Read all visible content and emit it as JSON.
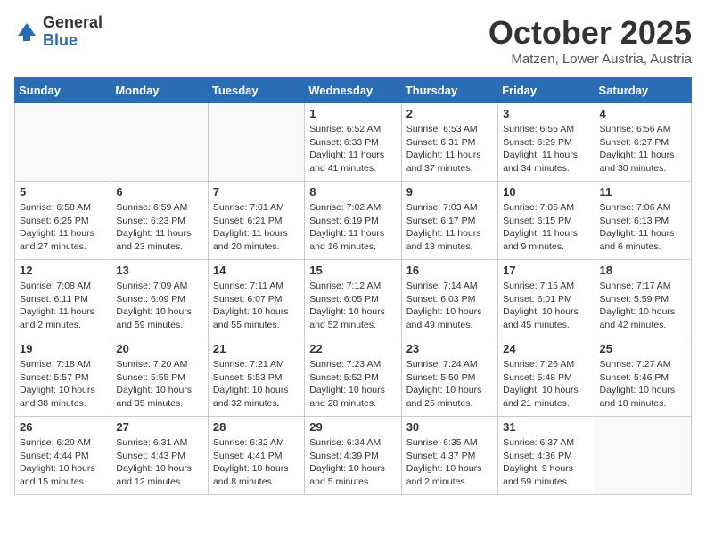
{
  "header": {
    "logo_general": "General",
    "logo_blue": "Blue",
    "title": "October 2025",
    "location": "Matzen, Lower Austria, Austria"
  },
  "weekdays": [
    "Sunday",
    "Monday",
    "Tuesday",
    "Wednesday",
    "Thursday",
    "Friday",
    "Saturday"
  ],
  "weeks": [
    [
      {
        "day": "",
        "info": ""
      },
      {
        "day": "",
        "info": ""
      },
      {
        "day": "",
        "info": ""
      },
      {
        "day": "1",
        "info": "Sunrise: 6:52 AM\nSunset: 6:33 PM\nDaylight: 11 hours\nand 41 minutes."
      },
      {
        "day": "2",
        "info": "Sunrise: 6:53 AM\nSunset: 6:31 PM\nDaylight: 11 hours\nand 37 minutes."
      },
      {
        "day": "3",
        "info": "Sunrise: 6:55 AM\nSunset: 6:29 PM\nDaylight: 11 hours\nand 34 minutes."
      },
      {
        "day": "4",
        "info": "Sunrise: 6:56 AM\nSunset: 6:27 PM\nDaylight: 11 hours\nand 30 minutes."
      }
    ],
    [
      {
        "day": "5",
        "info": "Sunrise: 6:58 AM\nSunset: 6:25 PM\nDaylight: 11 hours\nand 27 minutes."
      },
      {
        "day": "6",
        "info": "Sunrise: 6:59 AM\nSunset: 6:23 PM\nDaylight: 11 hours\nand 23 minutes."
      },
      {
        "day": "7",
        "info": "Sunrise: 7:01 AM\nSunset: 6:21 PM\nDaylight: 11 hours\nand 20 minutes."
      },
      {
        "day": "8",
        "info": "Sunrise: 7:02 AM\nSunset: 6:19 PM\nDaylight: 11 hours\nand 16 minutes."
      },
      {
        "day": "9",
        "info": "Sunrise: 7:03 AM\nSunset: 6:17 PM\nDaylight: 11 hours\nand 13 minutes."
      },
      {
        "day": "10",
        "info": "Sunrise: 7:05 AM\nSunset: 6:15 PM\nDaylight: 11 hours\nand 9 minutes."
      },
      {
        "day": "11",
        "info": "Sunrise: 7:06 AM\nSunset: 6:13 PM\nDaylight: 11 hours\nand 6 minutes."
      }
    ],
    [
      {
        "day": "12",
        "info": "Sunrise: 7:08 AM\nSunset: 6:11 PM\nDaylight: 11 hours\nand 2 minutes."
      },
      {
        "day": "13",
        "info": "Sunrise: 7:09 AM\nSunset: 6:09 PM\nDaylight: 10 hours\nand 59 minutes."
      },
      {
        "day": "14",
        "info": "Sunrise: 7:11 AM\nSunset: 6:07 PM\nDaylight: 10 hours\nand 55 minutes."
      },
      {
        "day": "15",
        "info": "Sunrise: 7:12 AM\nSunset: 6:05 PM\nDaylight: 10 hours\nand 52 minutes."
      },
      {
        "day": "16",
        "info": "Sunrise: 7:14 AM\nSunset: 6:03 PM\nDaylight: 10 hours\nand 49 minutes."
      },
      {
        "day": "17",
        "info": "Sunrise: 7:15 AM\nSunset: 6:01 PM\nDaylight: 10 hours\nand 45 minutes."
      },
      {
        "day": "18",
        "info": "Sunrise: 7:17 AM\nSunset: 5:59 PM\nDaylight: 10 hours\nand 42 minutes."
      }
    ],
    [
      {
        "day": "19",
        "info": "Sunrise: 7:18 AM\nSunset: 5:57 PM\nDaylight: 10 hours\nand 38 minutes."
      },
      {
        "day": "20",
        "info": "Sunrise: 7:20 AM\nSunset: 5:55 PM\nDaylight: 10 hours\nand 35 minutes."
      },
      {
        "day": "21",
        "info": "Sunrise: 7:21 AM\nSunset: 5:53 PM\nDaylight: 10 hours\nand 32 minutes."
      },
      {
        "day": "22",
        "info": "Sunrise: 7:23 AM\nSunset: 5:52 PM\nDaylight: 10 hours\nand 28 minutes."
      },
      {
        "day": "23",
        "info": "Sunrise: 7:24 AM\nSunset: 5:50 PM\nDaylight: 10 hours\nand 25 minutes."
      },
      {
        "day": "24",
        "info": "Sunrise: 7:26 AM\nSunset: 5:48 PM\nDaylight: 10 hours\nand 21 minutes."
      },
      {
        "day": "25",
        "info": "Sunrise: 7:27 AM\nSunset: 5:46 PM\nDaylight: 10 hours\nand 18 minutes."
      }
    ],
    [
      {
        "day": "26",
        "info": "Sunrise: 6:29 AM\nSunset: 4:44 PM\nDaylight: 10 hours\nand 15 minutes."
      },
      {
        "day": "27",
        "info": "Sunrise: 6:31 AM\nSunset: 4:43 PM\nDaylight: 10 hours\nand 12 minutes."
      },
      {
        "day": "28",
        "info": "Sunrise: 6:32 AM\nSunset: 4:41 PM\nDaylight: 10 hours\nand 8 minutes."
      },
      {
        "day": "29",
        "info": "Sunrise: 6:34 AM\nSunset: 4:39 PM\nDaylight: 10 hours\nand 5 minutes."
      },
      {
        "day": "30",
        "info": "Sunrise: 6:35 AM\nSunset: 4:37 PM\nDaylight: 10 hours\nand 2 minutes."
      },
      {
        "day": "31",
        "info": "Sunrise: 6:37 AM\nSunset: 4:36 PM\nDaylight: 9 hours\nand 59 minutes."
      },
      {
        "day": "",
        "info": ""
      }
    ]
  ]
}
